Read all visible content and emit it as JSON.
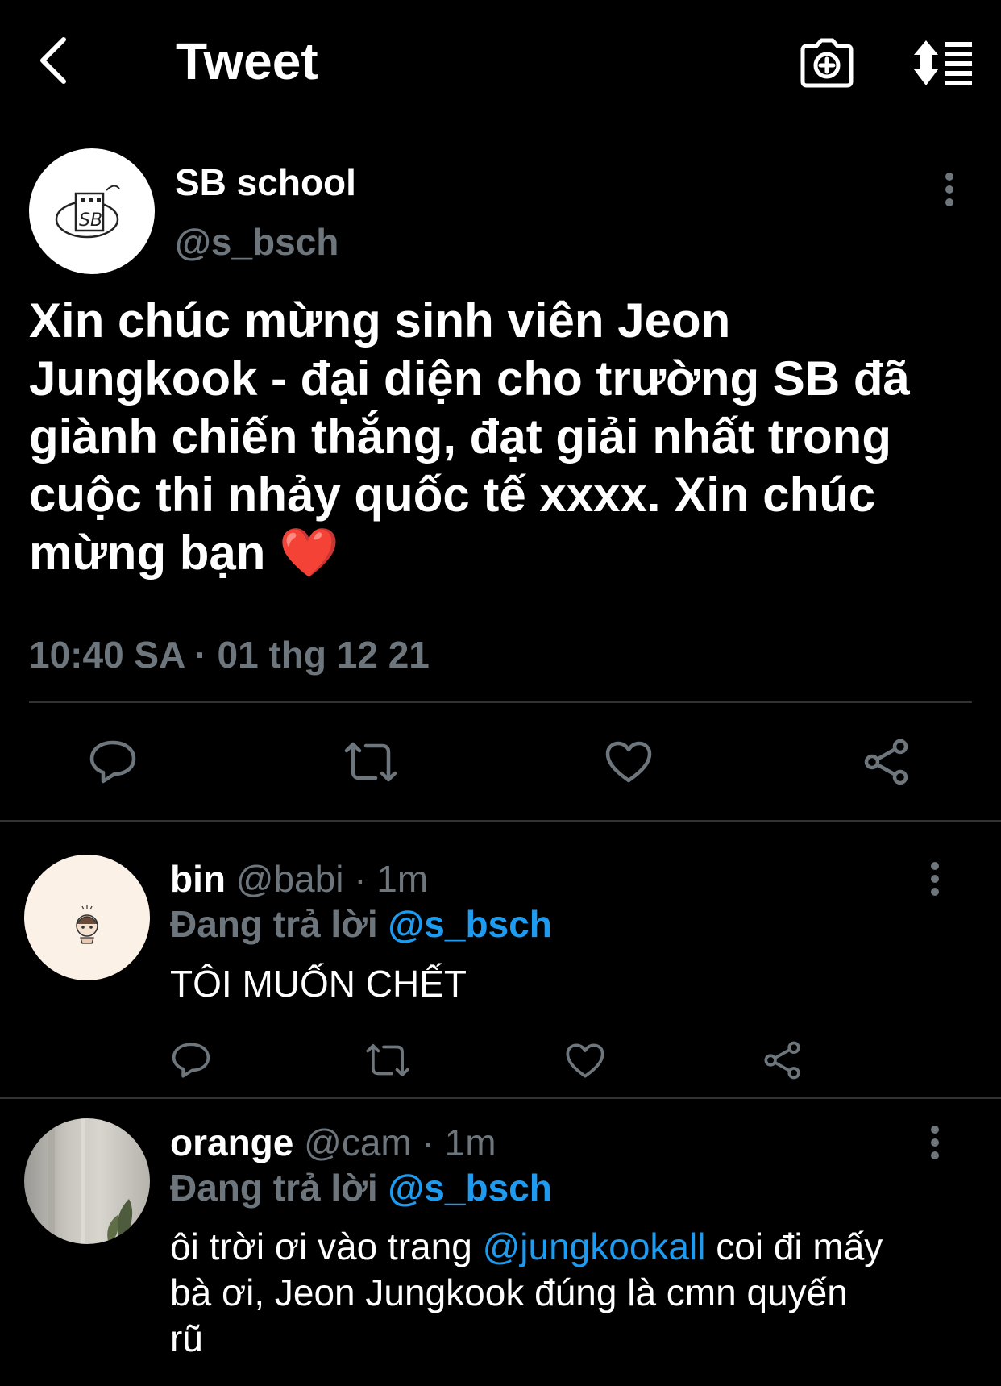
{
  "header": {
    "title": "Tweet",
    "back_icon": "chevron-left-icon",
    "camera_icon": "camera-plus-icon",
    "sort_icon": "sort-list-icon"
  },
  "main_tweet": {
    "author_name": "SB school",
    "author_handle": "@s_bsch",
    "avatar_text": "SB",
    "text_lines": [
      "Xin chúc mừng sinh viên Jeon",
      "Jungkook - đại diện cho trường SB đã",
      "giành chiến thắng, đạt giải nhất trong",
      "cuộc thi nhảy quốc tế xxxx. Xin chúc",
      "mừng bạn ❤️"
    ],
    "timestamp": "10:40 SA · 01 thg 12 21"
  },
  "replies": [
    {
      "name": "bin",
      "meta": "@babi · 1m",
      "replying_prefix": "Đang trả lời",
      "replying_to": "@s_bsch",
      "text": "TÔI MUỐN CHẾT"
    },
    {
      "name": "orange",
      "meta": "@cam · 1m",
      "replying_prefix": "Đang trả lời",
      "replying_to": "@s_bsch",
      "text_before": "ôi trời ơi vào trang",
      "mention": "@jungkookall",
      "text_after": "coi đi mấy",
      "text_line2": "bà ơi, Jeon Jungkook đúng là cmn quyến",
      "text_line3": "rũ"
    }
  ],
  "colors": {
    "background": "#000000",
    "muted": "#6e767d",
    "link": "#1d9bf0",
    "divider": "#2f3336"
  }
}
